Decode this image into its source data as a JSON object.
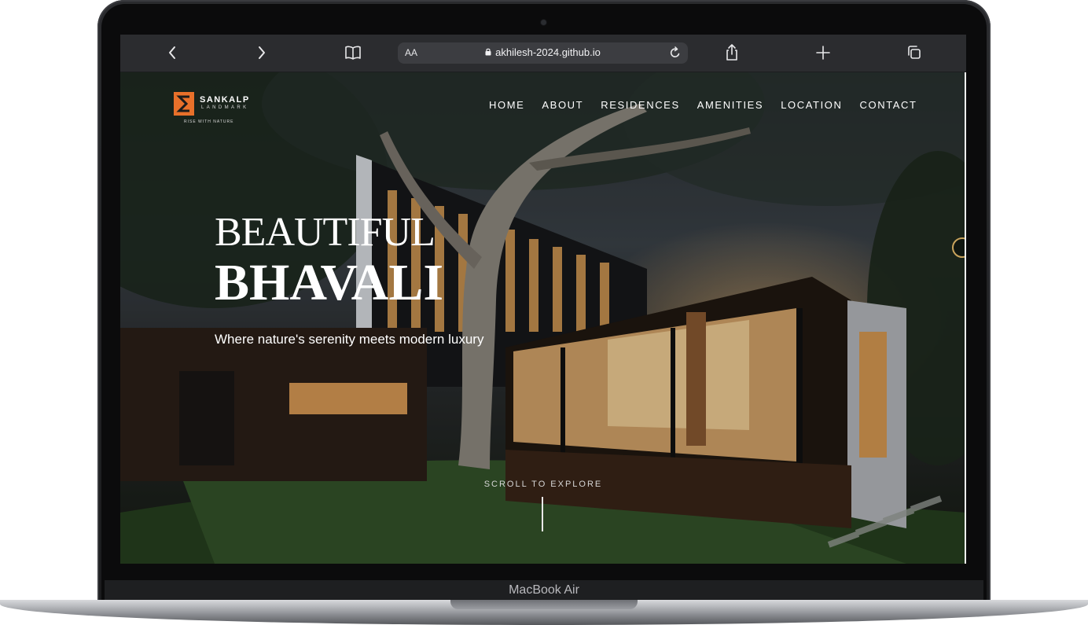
{
  "device": {
    "label": "MacBook Air"
  },
  "browser": {
    "text_size_label": "AA",
    "url": "akhilesh-2024.github.io",
    "icons": [
      "back-icon",
      "forward-icon",
      "bookmarks-icon",
      "lock-icon",
      "reload-icon",
      "share-icon",
      "new-tab-icon",
      "tabs-icon"
    ]
  },
  "site": {
    "logo": {
      "word": "SANKALP",
      "sub": "LANDMARK",
      "tagline": "RISE WITH NATURE",
      "brand_color": "#e8702a"
    },
    "nav": [
      "HOME",
      "ABOUT",
      "RESIDENCES",
      "AMENITIES",
      "LOCATION",
      "CONTACT"
    ],
    "hero": {
      "title_light": "BEAUTIFUL",
      "title_bold": "BHAVALI",
      "tagline": "Where nature's serenity meets modern luxury",
      "scroll_label": "SCROLL TO EXPLORE"
    },
    "accent_color": "#c9a35c"
  }
}
